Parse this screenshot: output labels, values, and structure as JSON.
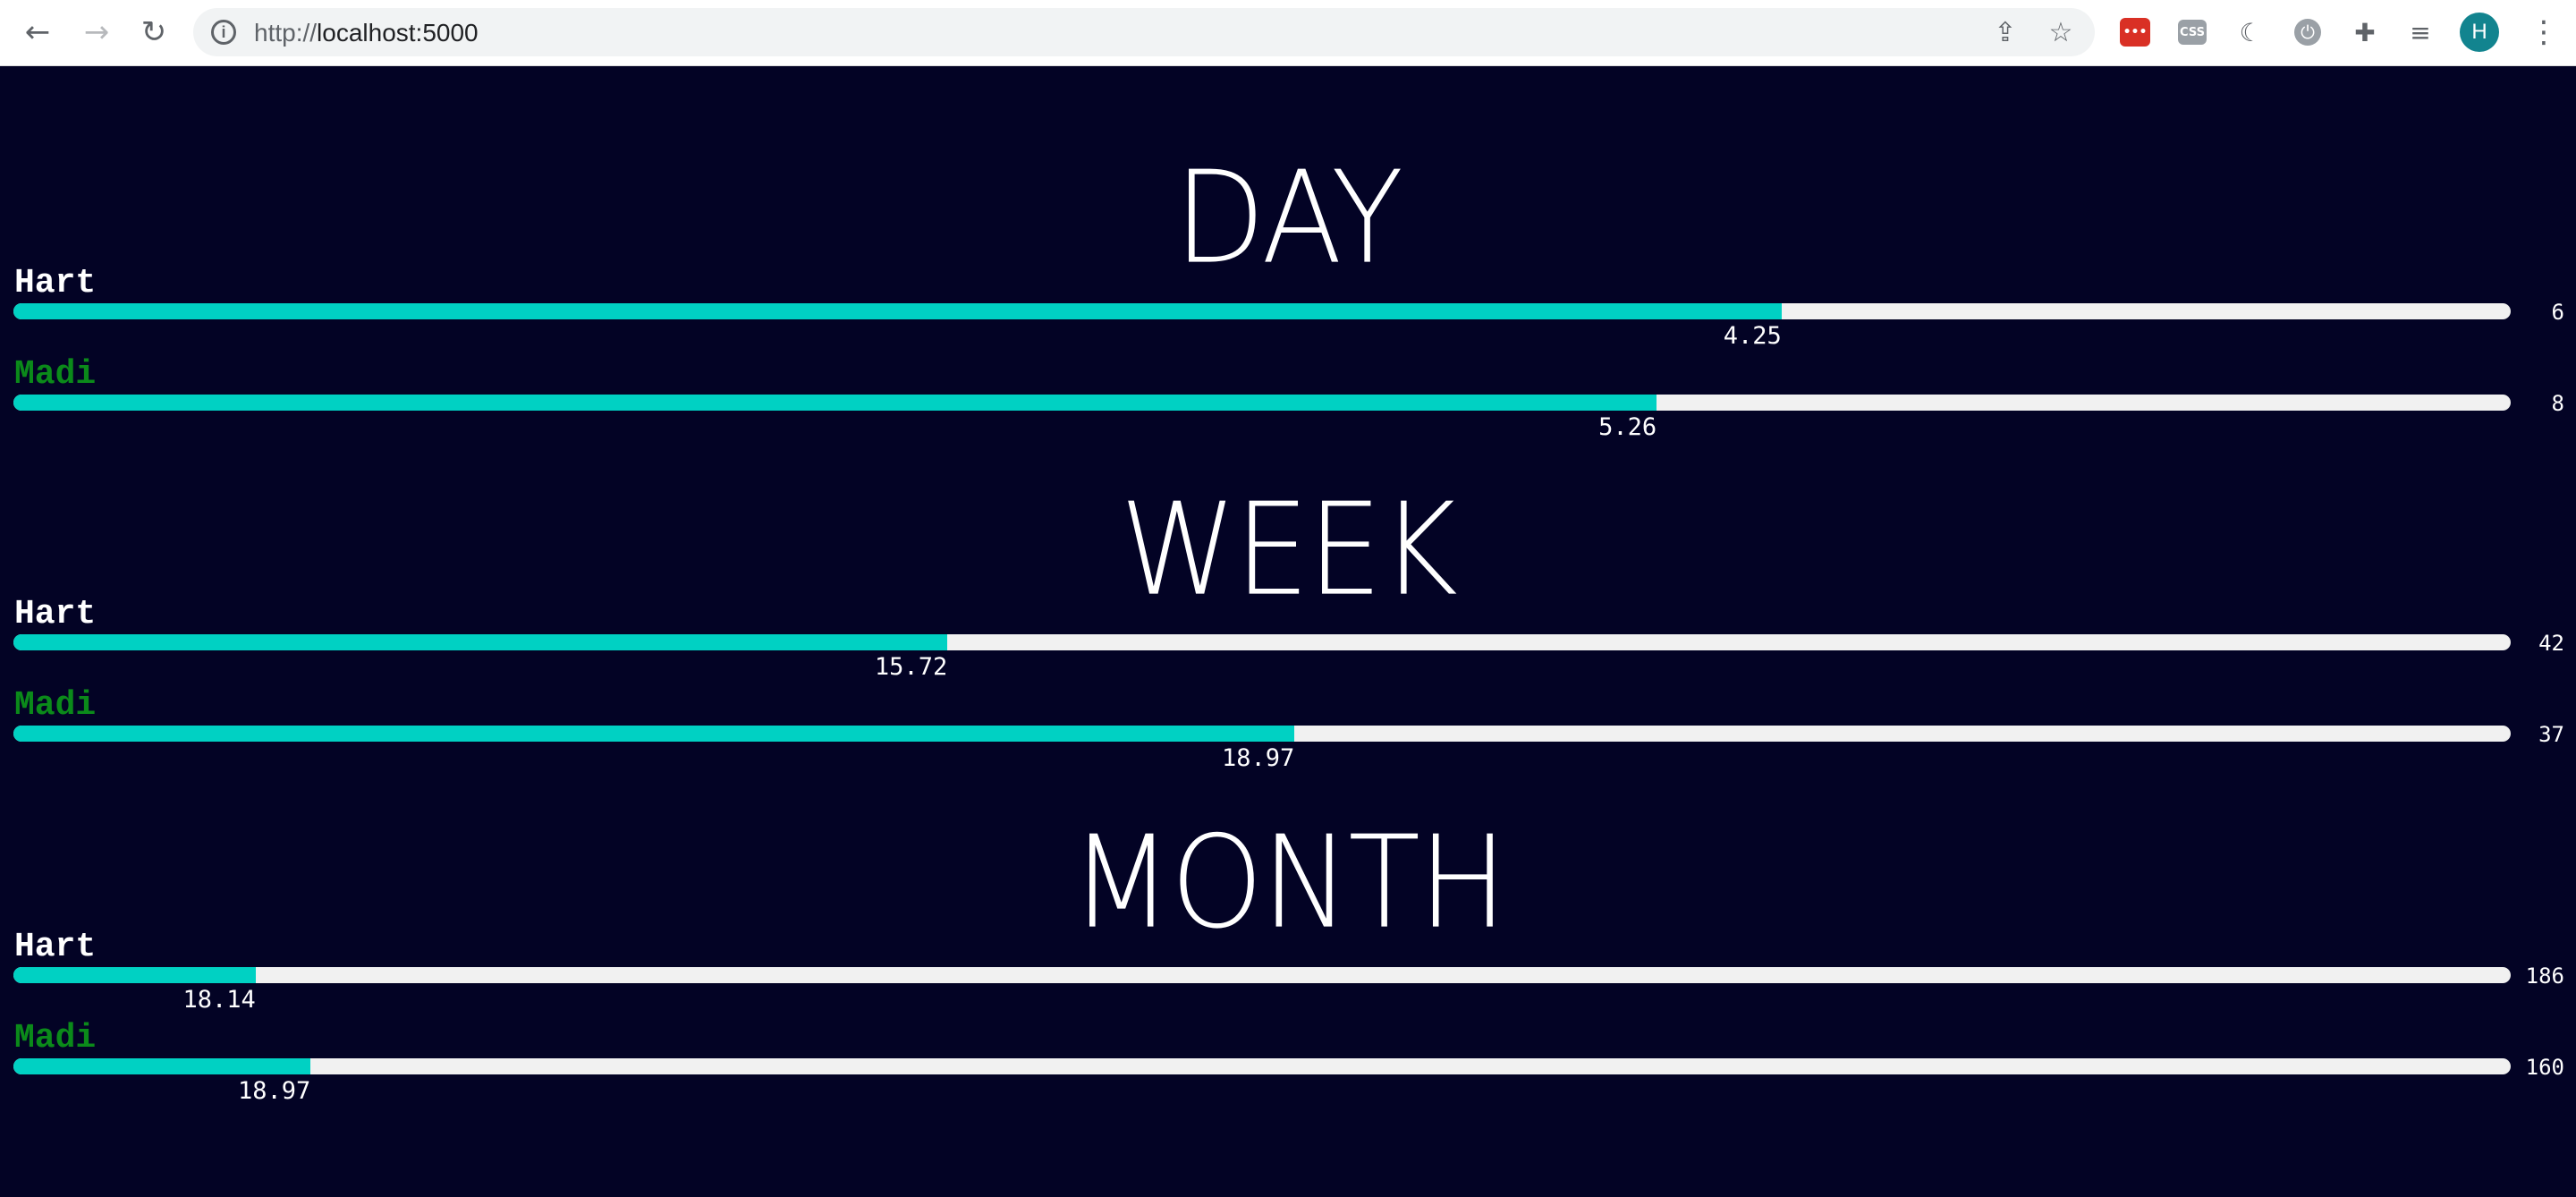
{
  "browser": {
    "url_scheme": "http://",
    "url_host": "localhost:5000",
    "profile_initial": "H",
    "extensions": [
      "lastpass-icon",
      "css-icon",
      "lighthouse-icon",
      "power-icon",
      "puzzle-icon",
      "media-icon"
    ],
    "ext_labels": {
      "red": "•••",
      "css": "CSS"
    }
  },
  "colors": {
    "background": "#030325",
    "fill": "#00d1c3",
    "track": "#f1f1f1",
    "hart_name": "#ffffff",
    "madi_name": "#0b8a1a"
  },
  "sections": [
    {
      "title": "DAY",
      "rows": [
        {
          "name": "Hart",
          "value": "4.25",
          "goal": "6",
          "progress": 0.708
        },
        {
          "name": "Madi",
          "value": "5.26",
          "goal": "8",
          "progress": 0.658
        }
      ]
    },
    {
      "title": "WEEK",
      "rows": [
        {
          "name": "Hart",
          "value": "15.72",
          "goal": "42",
          "progress": 0.374
        },
        {
          "name": "Madi",
          "value": "18.97",
          "goal": "37",
          "progress": 0.513
        }
      ]
    },
    {
      "title": "MONTH",
      "rows": [
        {
          "name": "Hart",
          "value": "18.14",
          "goal": "186",
          "progress": 0.097
        },
        {
          "name": "Madi",
          "value": "18.97",
          "goal": "160",
          "progress": 0.119
        }
      ]
    }
  ]
}
